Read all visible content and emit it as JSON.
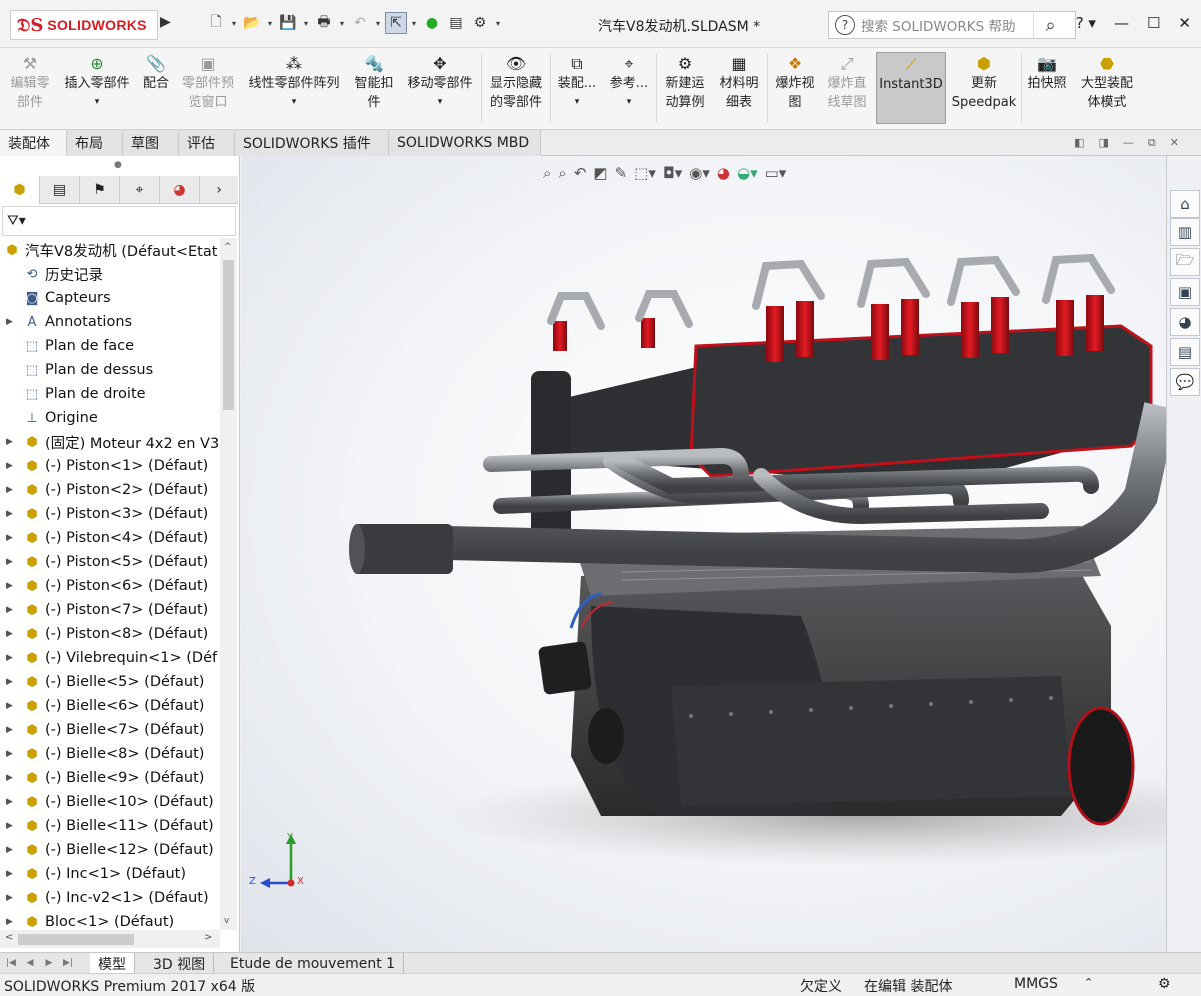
{
  "app": {
    "brand": "SOLIDWORKS",
    "document_title": "汽车V8发动机.SLDASM *"
  },
  "search": {
    "placeholder": "搜索 SOLIDWORKS 帮助"
  },
  "ribbon": {
    "edit_component": "编辑零\n部件",
    "insert_component": "插入零部件",
    "mate": "配合",
    "component_preview": "零部件预\n览窗口",
    "linear_pattern": "线性零部件阵列",
    "smart_fasteners": "智能扣\n件",
    "move_component": "移动零部件",
    "show_hidden": "显示隐藏\n的零部件",
    "assembly_features": "装配...",
    "reference": "参考...",
    "new_motion_study": "新建运\n动算例",
    "bom": "材料明\n细表",
    "exploded_view": "爆炸视\n图",
    "explode_line": "爆炸直\n线草图",
    "instant3d": "Instant3D",
    "update_speedpak": "更新\nSpeedpak",
    "snapshot": "拍快照",
    "large_assembly": "大型装配\n体模式"
  },
  "command_tabs": [
    "装配体",
    "布局",
    "草图",
    "评估",
    "SOLIDWORKS 插件",
    "SOLIDWORKS MBD"
  ],
  "tree": {
    "root": "汽车V8发动机  (Défaut<Etat",
    "items": [
      "历史记录",
      "Capteurs",
      "Annotations",
      "Plan de face",
      "Plan de dessus",
      "Plan de droite",
      "Origine",
      "(固定) Moteur 4x2 en V3",
      "(-) Piston<1> (Défaut)",
      "(-) Piston<2> (Défaut)",
      "(-) Piston<3> (Défaut)",
      "(-) Piston<4> (Défaut)",
      "(-) Piston<5> (Défaut)",
      "(-) Piston<6> (Défaut)",
      "(-) Piston<7> (Défaut)",
      "(-) Piston<8> (Défaut)",
      "(-) Vilebrequin<1> (Déf",
      "(-) Bielle<5> (Défaut)",
      "(-) Bielle<6> (Défaut)",
      "(-) Bielle<7> (Défaut)",
      "(-) Bielle<8> (Défaut)",
      "(-) Bielle<9> (Défaut)",
      "(-) Bielle<10> (Défaut)",
      "(-) Bielle<11> (Défaut)",
      "(-) Bielle<12> (Défaut)",
      "(-) Inc<1> (Défaut)",
      "(-) Inc-v2<1> (Défaut)",
      "Bloc<1> (Défaut)"
    ]
  },
  "triad": {
    "x": "X",
    "y": "Y",
    "z": "Z"
  },
  "bottom_tabs": [
    "模型",
    "3D 视图",
    "Etude de mouvement 1"
  ],
  "status": {
    "product": "SOLIDWORKS Premium 2017 x64 版",
    "underdefined": "欠定义",
    "editing": "在编辑 装配体",
    "units": "MMGS",
    "units_arrow": "⌃"
  },
  "colors": {
    "brand_red": "#d71920",
    "viewport_bg": "#f4f6f9",
    "spring_red": "#d0101a",
    "engine_dark": "#3a3a3c"
  }
}
